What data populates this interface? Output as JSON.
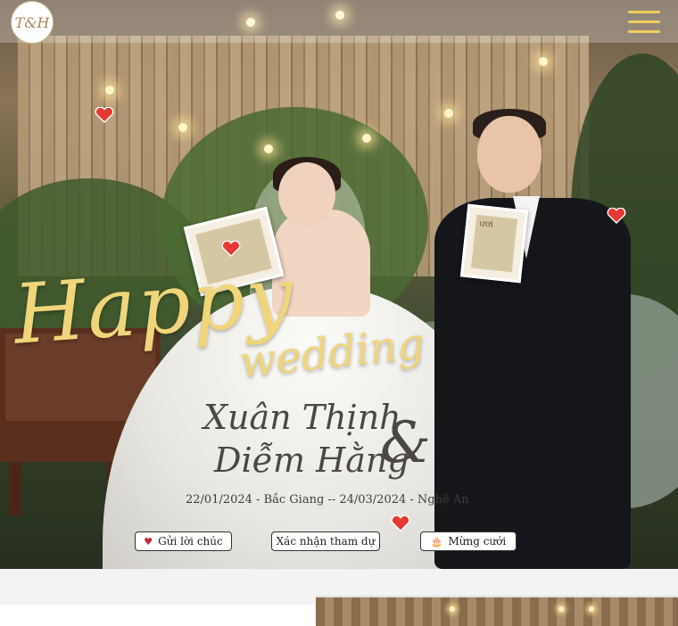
{
  "header": {
    "logo_text": "T&H",
    "menu_icon": "hamburger-icon",
    "accent_color": "#f1cd5f"
  },
  "hero": {
    "happy": "Happy",
    "wedding": "wedding",
    "groom_name": "Xuân Thịnh",
    "ampersand": "&",
    "bride_name": "Diễm Hằng",
    "dates": "22/01/2024 - Bắc Giang  --  24/03/2024 - Nghệ An",
    "script_color": "#f0d57a",
    "name_color": "#4a4744"
  },
  "props": {
    "card_left_text": "",
    "card_right_text": "ươi"
  },
  "actions": {
    "send_wishes": "Gửi lời chúc",
    "confirm_attendance": "Xác nhận tham dự",
    "gift": "Mừng cưới",
    "send_wishes_icon": "heart-icon",
    "gift_icon": "gift-icon"
  },
  "decor": {
    "heart_color": "#e53935"
  }
}
